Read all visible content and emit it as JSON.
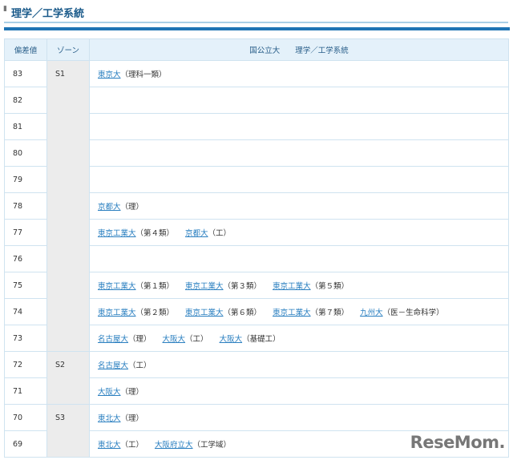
{
  "title": "理学／工学系統",
  "header": {
    "hensachi": "偏差値",
    "zone": "ゾーン",
    "category": "国公立大　　理学／工学系統"
  },
  "rows": [
    {
      "hensachi": "83",
      "zone": "S1",
      "zone_span": 11,
      "entries": [
        {
          "name": "東京大",
          "note": "（理科一類）"
        }
      ]
    },
    {
      "hensachi": "82",
      "entries": []
    },
    {
      "hensachi": "81",
      "entries": []
    },
    {
      "hensachi": "80",
      "entries": []
    },
    {
      "hensachi": "79",
      "entries": []
    },
    {
      "hensachi": "78",
      "entries": [
        {
          "name": "京都大",
          "note": "（理）"
        }
      ]
    },
    {
      "hensachi": "77",
      "entries": [
        {
          "name": "東京工業大",
          "note": "（第４類）"
        },
        {
          "name": "京都大",
          "note": "（工）"
        }
      ]
    },
    {
      "hensachi": "76",
      "entries": []
    },
    {
      "hensachi": "75",
      "entries": [
        {
          "name": "東京工業大",
          "note": "（第１類）"
        },
        {
          "name": "東京工業大",
          "note": "（第３類）"
        },
        {
          "name": "東京工業大",
          "note": "（第５類）"
        }
      ]
    },
    {
      "hensachi": "74",
      "entries": [
        {
          "name": "東京工業大",
          "note": "（第２類）"
        },
        {
          "name": "東京工業大",
          "note": "（第６類）"
        },
        {
          "name": "東京工業大",
          "note": "（第７類）"
        },
        {
          "name": "九州大",
          "note": "（医－生命科学）"
        }
      ]
    },
    {
      "hensachi": "73",
      "entries": [
        {
          "name": "名古屋大",
          "note": "（理）"
        },
        {
          "name": "大阪大",
          "note": "（工）"
        },
        {
          "name": "大阪大",
          "note": "（基礎工）"
        }
      ]
    },
    {
      "hensachi": "72",
      "zone": "S2",
      "zone_span": 2,
      "entries": [
        {
          "name": "名古屋大",
          "note": "（工）"
        }
      ]
    },
    {
      "hensachi": "71",
      "entries": [
        {
          "name": "大阪大",
          "note": "（理）"
        }
      ]
    },
    {
      "hensachi": "70",
      "zone": "S3",
      "zone_span": 2,
      "entries": [
        {
          "name": "東北大",
          "note": "（理）"
        }
      ]
    },
    {
      "hensachi": "69",
      "entries": [
        {
          "name": "東北大",
          "note": "（工）"
        },
        {
          "name": "大阪府立大",
          "note": "（工学域）"
        }
      ]
    }
  ],
  "logo": "ReseMom"
}
